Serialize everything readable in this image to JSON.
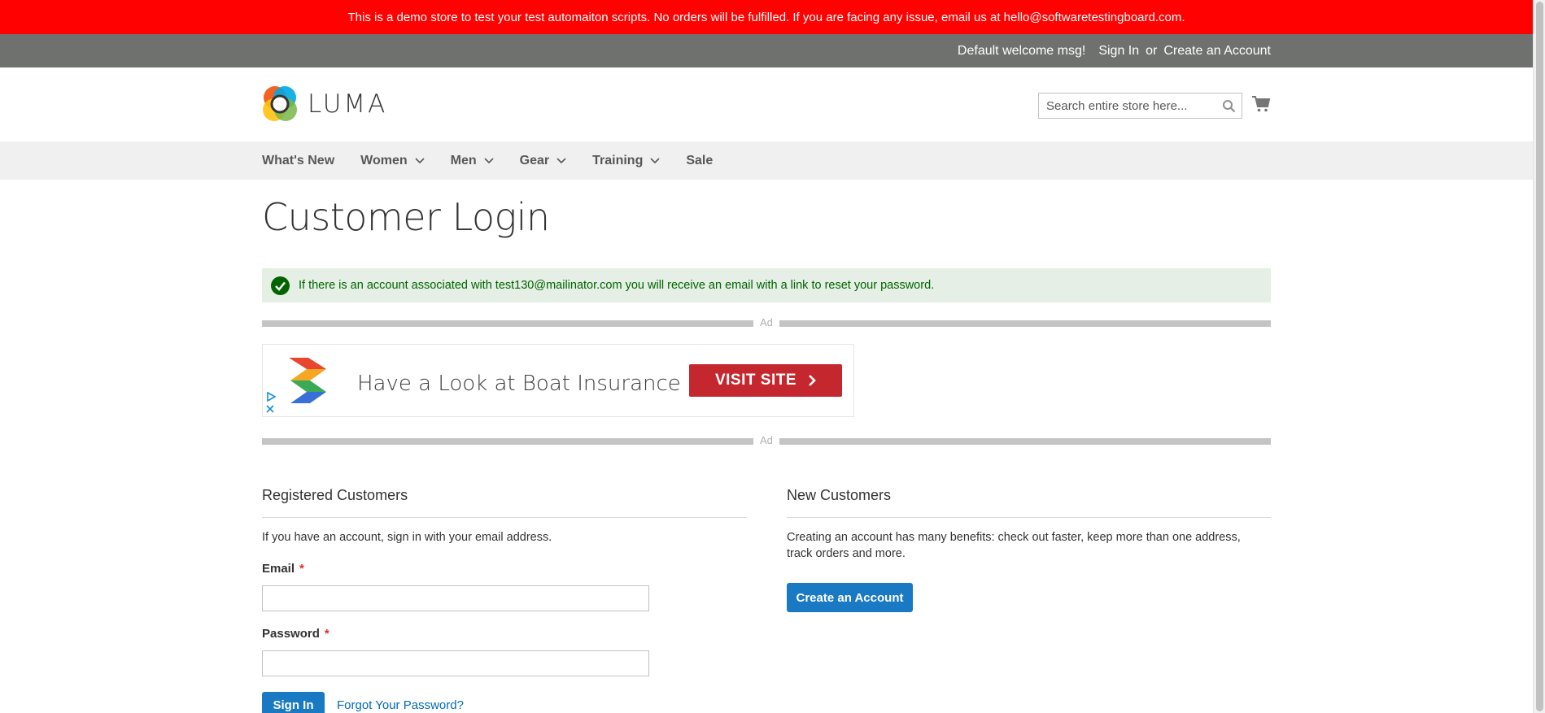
{
  "demo_notice": "This is a demo store to test your test automaiton scripts. No orders will be fulfilled. If you are facing any issue, email us at hello@softwaretestingboard.com.",
  "header": {
    "welcome": "Default welcome msg!",
    "sign_in": "Sign In",
    "or": "or",
    "create_account": "Create an Account"
  },
  "logo_text": "LUMA",
  "search": {
    "placeholder": "Search entire store here..."
  },
  "nav": {
    "items": [
      {
        "label": "What's New",
        "has_dropdown": false
      },
      {
        "label": "Women",
        "has_dropdown": true
      },
      {
        "label": "Men",
        "has_dropdown": true
      },
      {
        "label": "Gear",
        "has_dropdown": true
      },
      {
        "label": "Training",
        "has_dropdown": true
      },
      {
        "label": "Sale",
        "has_dropdown": false
      }
    ]
  },
  "page_title": "Customer Login",
  "success_message": "If there is an account associated with test130@mailinator.com you will receive an email with a link to reset your password.",
  "ad": {
    "label": "Ad",
    "headline": "Have a Look at Boat Insurance",
    "button": "VISIT SITE"
  },
  "registered": {
    "title": "Registered Customers",
    "intro": "If you have an account, sign in with your email address.",
    "email_label": "Email",
    "email_value": "",
    "password_label": "Password",
    "password_value": "",
    "required_mark": "*",
    "sign_in_button": "Sign In",
    "forgot_link": "Forgot Your Password?"
  },
  "new_customers": {
    "title": "New Customers",
    "text": "Creating an account has many benefits: check out faster, keep more than one address, track orders and more.",
    "create_button": "Create an Account"
  },
  "colors": {
    "demo_bar": "#ff0101",
    "panel_header": "#6e716e",
    "primary_button": "#1979c3",
    "success_bg": "#e5efe5",
    "success_text": "#006400",
    "ad_button": "#c4272d"
  }
}
